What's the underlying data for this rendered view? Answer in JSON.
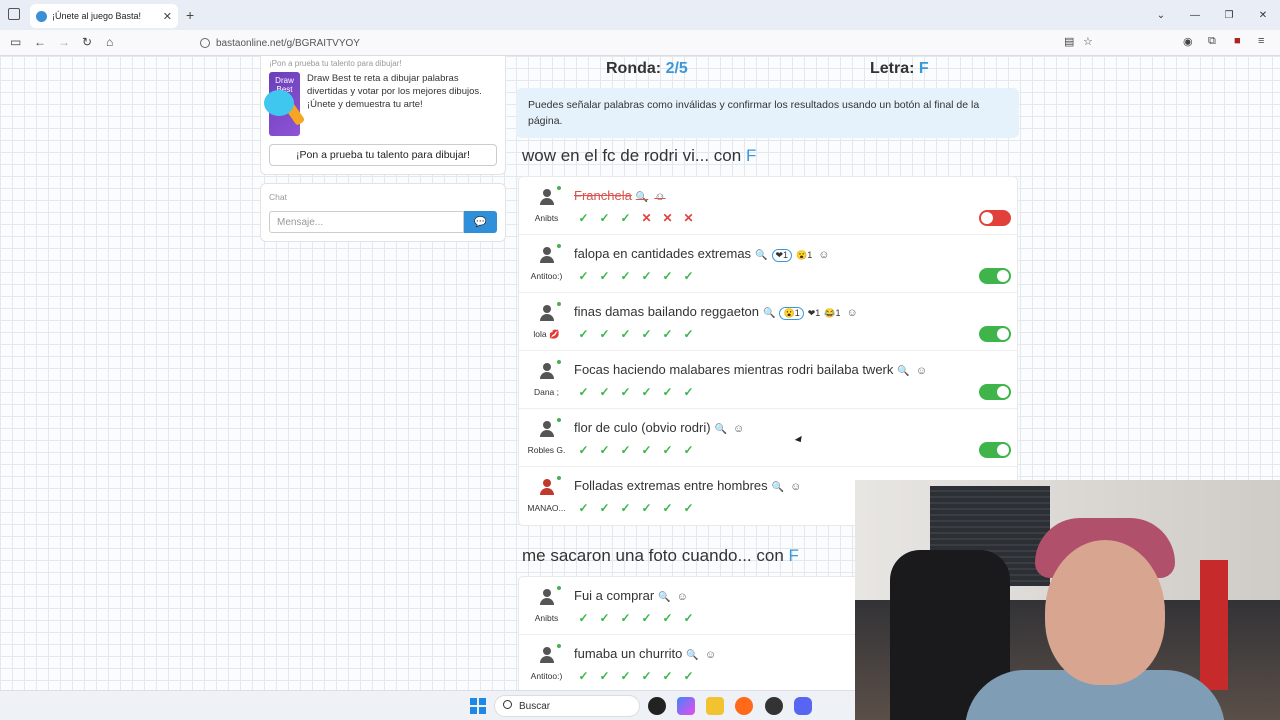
{
  "browser": {
    "tab_title": "¡Únete al juego Basta!",
    "url": "bastaonline.net/g/BGRAITVYOY"
  },
  "sidebar": {
    "ad_header": "¡Pon a prueba tu talento para dibujar!",
    "ad_image_label": "Draw Best",
    "ad_text": "Draw Best te reta a dibujar palabras divertidas y votar por los mejores dibujos. ¡Únete y demuestra tu arte!",
    "ad_button": "¡Pon a prueba tu talento para dibujar!",
    "chat_label": "Chat",
    "chat_placeholder": "Mensaje..."
  },
  "game": {
    "ronda_label": "Ronda:",
    "ronda_value": "2/5",
    "letra_label": "Letra:",
    "letra_value": "F",
    "info": "Puedes señalar palabras como inválidas y confirmar los resultados usando un botón al final de la página."
  },
  "categories": [
    {
      "title": "wow en el fc de rodri vi... con",
      "letter": "F",
      "answers": [
        {
          "player": "Anibts",
          "word": "Franchela",
          "reactions": [],
          "votes": [
            "check",
            "check",
            "check",
            "x",
            "x",
            "x"
          ],
          "valid": false
        },
        {
          "player": "Antitoo:)",
          "word": "falopa en cantidades extremas",
          "reactions": [
            "❤1",
            "😮1"
          ],
          "votes": [
            "check",
            "check",
            "check",
            "check",
            "check",
            "check"
          ],
          "valid": true
        },
        {
          "player": "lola 💋",
          "word": "finas damas bailando reggaeton",
          "reactions": [
            "😮1",
            "❤1",
            "😂1"
          ],
          "votes": [
            "check",
            "check",
            "check",
            "check",
            "check",
            "check"
          ],
          "valid": true
        },
        {
          "player": "Dana ;",
          "word": "Focas haciendo malabares mientras rodri bailaba twerk",
          "reactions": [],
          "votes": [
            "check",
            "check",
            "check",
            "check",
            "check",
            "check"
          ],
          "valid": true
        },
        {
          "player": "Robles G.",
          "word": "flor de culo (obvio rodri)",
          "reactions": [],
          "votes": [
            "check",
            "check",
            "check",
            "check",
            "check",
            "check"
          ],
          "valid": true
        },
        {
          "player": "MANAO...",
          "word": "Folladas extremas entre hombres",
          "reactions": [],
          "votes": [
            "check",
            "check",
            "check",
            "check",
            "check",
            "check"
          ],
          "valid": true
        }
      ]
    },
    {
      "title": "me sacaron una foto cuando... con",
      "letter": "F",
      "answers": [
        {
          "player": "Anibts",
          "word": "Fui a comprar",
          "reactions": [],
          "votes": [
            "check",
            "check",
            "check",
            "check",
            "check",
            "check"
          ],
          "valid": true
        },
        {
          "player": "Antitoo:)",
          "word": "fumaba un churrito",
          "reactions": [],
          "votes": [
            "check",
            "check",
            "check",
            "check",
            "check",
            "check"
          ],
          "valid": true
        }
      ]
    }
  ],
  "taskbar": {
    "search_placeholder": "Buscar"
  }
}
